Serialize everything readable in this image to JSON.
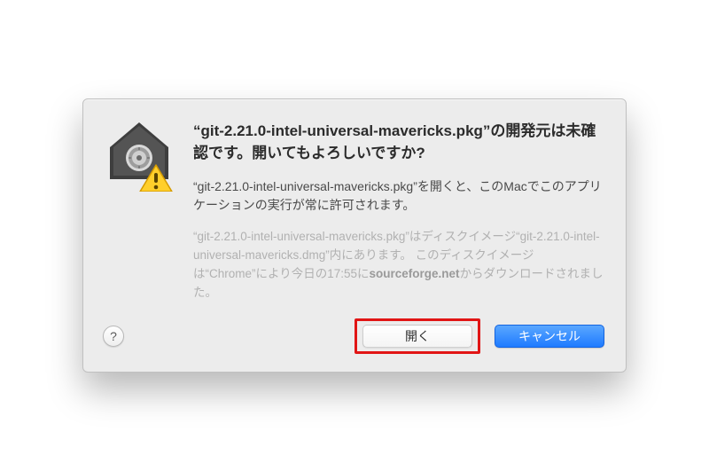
{
  "dialog": {
    "title": "“git-2.21.0-intel-universal-mavericks.pkg”の開発元は未確認です。開いてもよろしいですか?",
    "message": "“git-2.21.0-intel-universal-mavericks.pkg”を開くと、このMacでこのアプリケーションの実行が常に許可されます。",
    "info_pre": "“git-2.21.0-intel-universal-mavericks.pkg”はディスクイメージ“git-2.21.0-intel-universal-mavericks.dmg”内にあります。 このディスクイメージは“Chrome”により今日の17:55に",
    "info_bold": "sourceforge.net",
    "info_post": "からダウンロードされました。"
  },
  "buttons": {
    "open": "開く",
    "cancel": "キャンセル",
    "help": "?"
  },
  "icons": {
    "security": "security-house-lock-icon",
    "warning": "warning-triangle-icon"
  }
}
